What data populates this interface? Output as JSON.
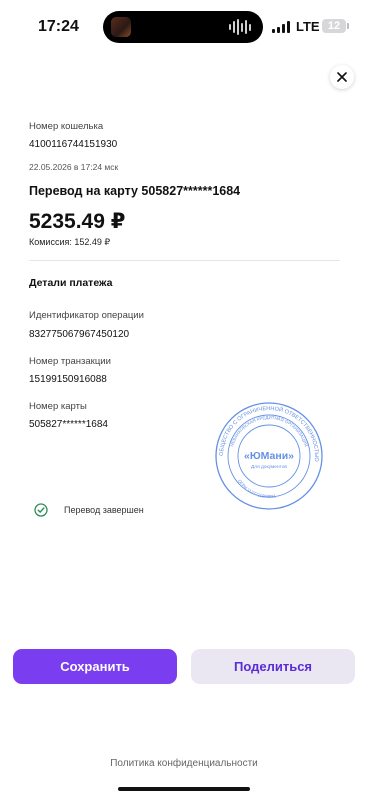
{
  "status_bar": {
    "time": "17:24",
    "network": "LTE",
    "battery": "12"
  },
  "wallet": {
    "label": "Номер кошелька",
    "number": "4100116744151930"
  },
  "datetime": "22.05.2026 в 17:24 мск",
  "title": "Перевод на карту 505827******1684",
  "amount": "5235.49 ₽",
  "fee": "Комиссия: 152.49 ₽",
  "details": {
    "heading": "Детали платежа",
    "operation_id": {
      "label": "Идентификатор операции",
      "value": "832775067967450120"
    },
    "transaction": {
      "label": "Номер транзакции",
      "value": "15199150916088"
    },
    "card": {
      "label": "Номер карты",
      "value": "505827******1684"
    }
  },
  "stamp": {
    "outer_text": "ОБЩЕСТВО С ОГРАНИЧЕННОЙ ОТВЕТСТВЕННОСТЬЮ",
    "inner_text": "НЕБАНКОВСКАЯ КРЕДИТНАЯ ОРГАНИЗАЦИЯ",
    "ogrn": "ОГРН 1127711000031",
    "brand": "«ЮМани»",
    "caption": "Для документов",
    "color": "#3a6fd8"
  },
  "transfer_status": "Перевод завершен",
  "buttons": {
    "save": "Сохранить",
    "share": "Поделиться"
  },
  "footer": {
    "privacy": "Политика конфиденциальности"
  },
  "colors": {
    "accent": "#7b3df0",
    "share_bg": "#ebe7f2",
    "success": "#2e8b57"
  }
}
